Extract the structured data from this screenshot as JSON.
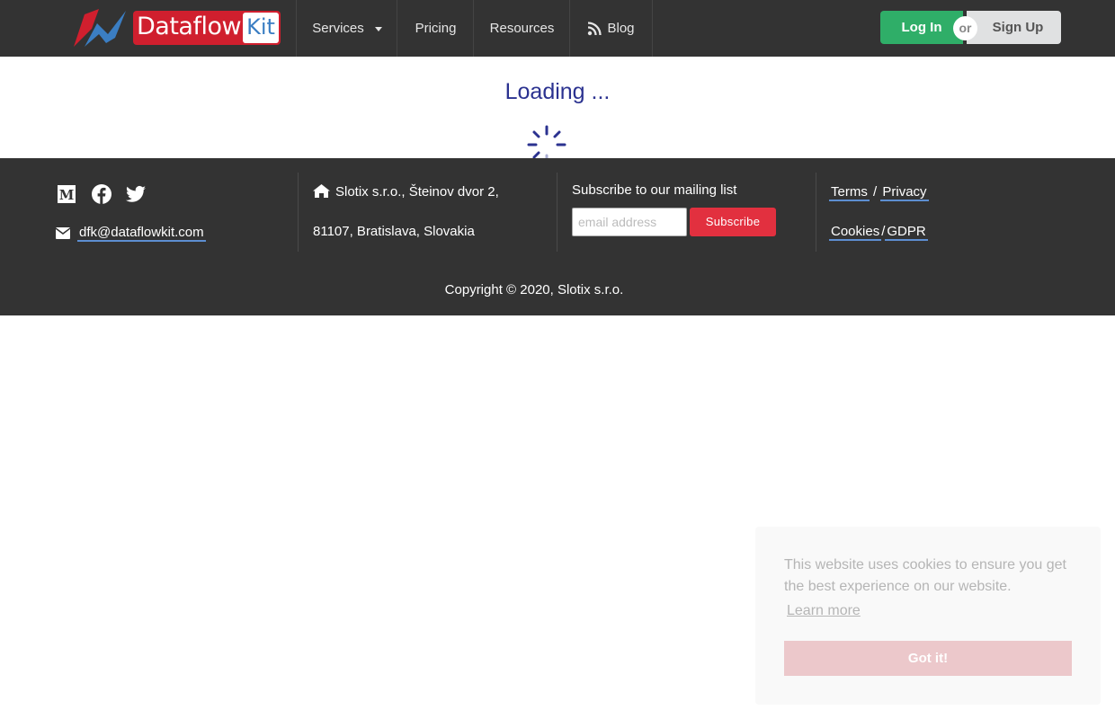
{
  "header": {
    "logo_text": "Dataflow",
    "logo_kit": "Kit",
    "nav": {
      "services": "Services",
      "pricing": "Pricing",
      "resources": "Resources",
      "blog": "Blog"
    },
    "login_label": "Log In",
    "or_label": "or",
    "signup_label": "Sign Up",
    "colors": {
      "background": "#333333",
      "login": "#2fae68",
      "signup": "#e0e1e2",
      "logo_red": "#d01f2e",
      "logo_blue": "#3b7ec3"
    }
  },
  "main": {
    "loading_text": "Loading ...",
    "loading_color": "#2b3290"
  },
  "footer": {
    "social": [
      "medium-icon",
      "facebook-icon",
      "twitter-icon"
    ],
    "email": "dfk@dataflowkit.com",
    "address_line1": "Slotix s.r.o., Šteinov dvor 2,",
    "address_line2": "81107, Bratislava, Slovakia",
    "subscribe_label": "Subscribe to our mailing list",
    "email_placeholder": "email address",
    "subscribe_button": "Subscribe",
    "terms": "Terms",
    "privacy": "Privacy",
    "cookies": "Cookies",
    "gdpr": "GDPR",
    "slash": "/",
    "copyright": "Copyright © 2020, Slotix s.r.o."
  },
  "cookie_banner": {
    "message": "This website uses cookies to ensure you get the best experience on our website.",
    "learn_more": "Learn more",
    "accept": "Got it!"
  }
}
